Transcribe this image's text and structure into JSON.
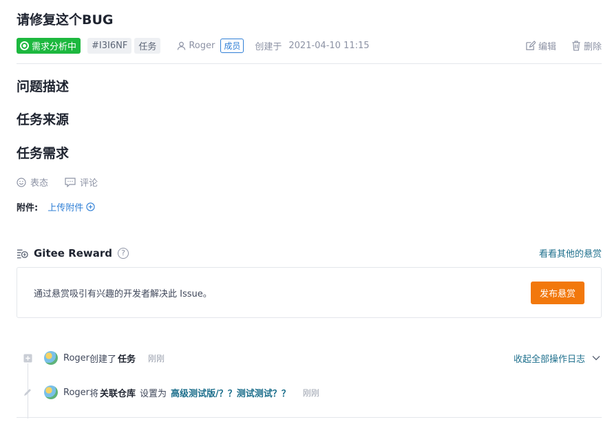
{
  "issue": {
    "title": "请修复这个BUG",
    "status_label": "需求分析中",
    "issue_id": "#I3I6NF",
    "type_label": "任务",
    "author": "Roger",
    "role_label": "成员",
    "created_label": "创建于",
    "created_time": "2021-04-10 11:15",
    "edit_label": "编辑",
    "delete_label": "删除",
    "status_color": "#1db83f"
  },
  "sections": {
    "description": "问题描述",
    "source": "任务来源",
    "requirements": "任务需求"
  },
  "reactions": {
    "react_label": "表态",
    "comment_label": "评论"
  },
  "attachments": {
    "label": "附件:",
    "upload_label": "上传附件"
  },
  "reward": {
    "title": "Gitee Reward",
    "other_link": "看看其他的悬赏",
    "description": "通过悬赏吸引有兴趣的开发者解决此 Issue。",
    "button_label": "发布悬赏",
    "button_color": "#f2780c"
  },
  "activity": {
    "collapse_label": "收起全部操作日志",
    "logs": [
      {
        "user": "Roger",
        "action": "创建了",
        "target": "任务",
        "time": "刚刚"
      },
      {
        "user": "Roger",
        "action": "将",
        "field": "关联仓库",
        "verb": "设置为",
        "value": "高级测试版/？？测试测试？？",
        "time": "刚刚"
      }
    ]
  }
}
